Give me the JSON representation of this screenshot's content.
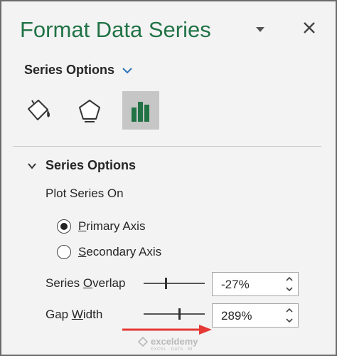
{
  "panel": {
    "title": "Format Data Series",
    "pin_icon": "chevron-down-icon",
    "close_icon": "close-icon",
    "title_color": "#217346"
  },
  "series_dropdown": {
    "label": "Series Options",
    "icon": "chevron-down-icon",
    "accent": "#2e75b6"
  },
  "icon_tabs": [
    {
      "name": "fill-line",
      "icon": "paint-bucket-icon",
      "selected": false
    },
    {
      "name": "effects",
      "icon": "pentagon-icon",
      "selected": false
    },
    {
      "name": "series-options",
      "icon": "bar-chart-icon",
      "selected": true,
      "color": "#217346"
    }
  ],
  "section": {
    "title": "Series Options",
    "expanded": true,
    "plot_on_label": "Plot Series On",
    "radios": [
      {
        "label_pre": "",
        "label_key": "P",
        "label_post": "rimary Axis",
        "checked": true
      },
      {
        "label_pre": "",
        "label_key": "S",
        "label_post": "econdary Axis",
        "checked": false
      }
    ],
    "series_overlap": {
      "label_pre": "Series ",
      "label_key": "O",
      "label_post": "verlap",
      "value": "-27%",
      "slider_fraction": 0.365
    },
    "gap_width": {
      "label_pre": "Gap ",
      "label_key": "W",
      "label_post": "idth",
      "value": "289%",
      "slider_fraction": 0.58
    }
  },
  "annotation": {
    "arrow_color": "#e53935"
  },
  "watermark": {
    "name": "exceldemy",
    "tagline": "EXCEL · DATA · BI"
  }
}
